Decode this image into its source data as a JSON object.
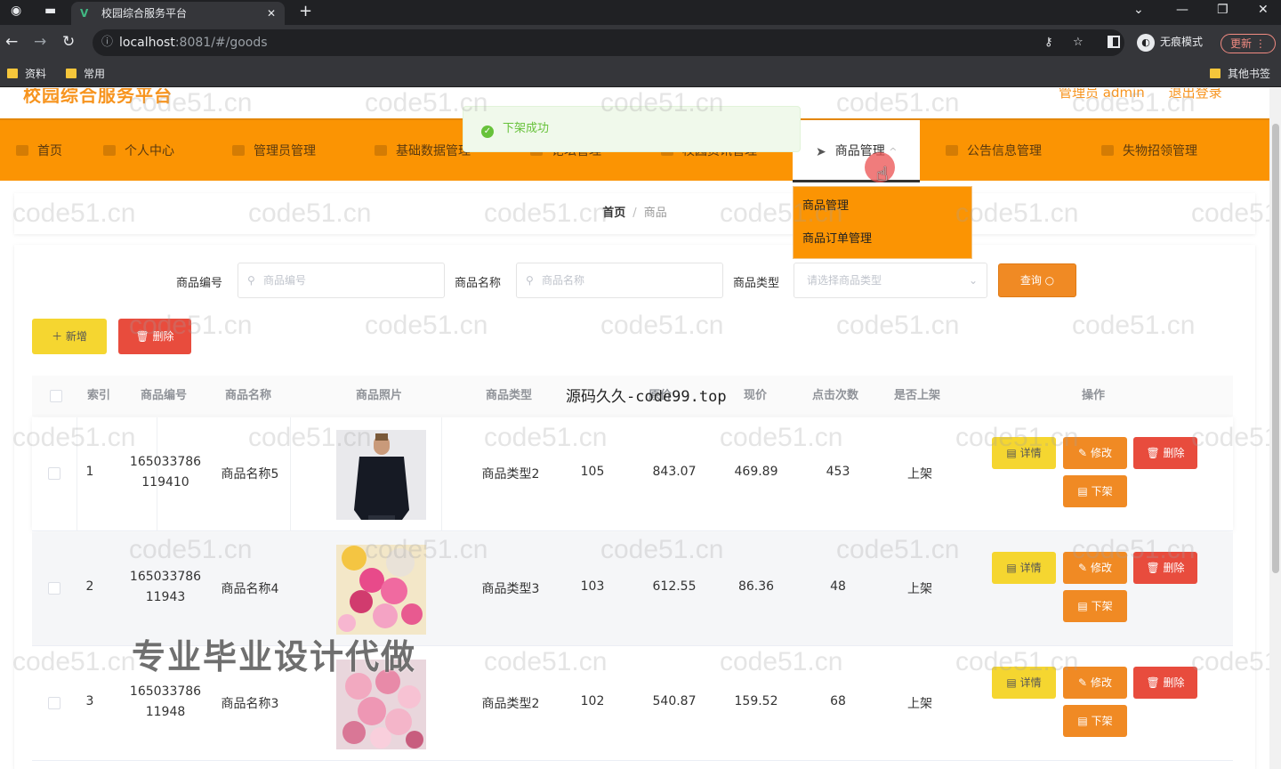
{
  "browser": {
    "tab_title": "校园综合服务平台",
    "tab_icon": "V",
    "new_tab": "+",
    "url_host": "localhost",
    "url_path": ":8081/#/goods",
    "incognito_label": "无痕模式",
    "update_label": "更新",
    "bookmarks": [
      "资料",
      "常用"
    ],
    "other_bookmarks": "其他书签"
  },
  "header": {
    "site_title": "校园综合服务平台",
    "admin_label": "管理员 admin",
    "logout": "退出登录"
  },
  "menu": [
    {
      "label": "首页"
    },
    {
      "label": "个人中心"
    },
    {
      "label": "管理员管理"
    },
    {
      "label": "基础数据管理"
    },
    {
      "label": "论坛管理"
    },
    {
      "label": "校园资讯管理"
    },
    {
      "label": "商品管理"
    },
    {
      "label": "公告信息管理"
    },
    {
      "label": "失物招领管理"
    }
  ],
  "dropdown": [
    "商品管理",
    "商品订单管理"
  ],
  "toast": "下架成功",
  "breadcrumb": {
    "home": "首页",
    "sep": "/",
    "current": "商品"
  },
  "search": {
    "code_label": "商品编号",
    "code_placeholder": "商品编号",
    "name_label": "商品名称",
    "name_placeholder": "商品名称",
    "type_label": "商品类型",
    "type_placeholder": "请选择商品类型",
    "query_button": "查询"
  },
  "actions": {
    "add": "新增",
    "delete": "删除"
  },
  "table": {
    "columns": [
      "索引",
      "商品编号",
      "商品名称",
      "商品照片",
      "商品类型",
      "原价",
      "现价",
      "点击次数",
      "是否上架",
      "操作"
    ],
    "rows": [
      {
        "index": "1",
        "code_a": "165033786",
        "code_b": "119410",
        "name": "商品名称5",
        "type": "商品类型2",
        "stock": "105",
        "original": "843.07",
        "price": "469.89",
        "clicks": "453",
        "status": "上架"
      },
      {
        "index": "2",
        "code_a": "165033786",
        "code_b": "11943",
        "name": "商品名称4",
        "type": "商品类型3",
        "stock": "103",
        "original": "612.55",
        "price": "86.36",
        "clicks": "48",
        "status": "上架"
      },
      {
        "index": "3",
        "code_a": "165033786",
        "code_b": "11948",
        "name": "商品名称3",
        "type": "商品类型2",
        "stock": "102",
        "original": "540.87",
        "price": "159.52",
        "clicks": "68",
        "status": "上架"
      }
    ],
    "row_buttons": {
      "detail": "详情",
      "edit": "修改",
      "remove": "删除",
      "off": "下架"
    }
  },
  "overlays": {
    "watermark": "code51.cn",
    "source_text": "源码久久-code99.top",
    "promo_text": "专业毕业设计代做"
  }
}
